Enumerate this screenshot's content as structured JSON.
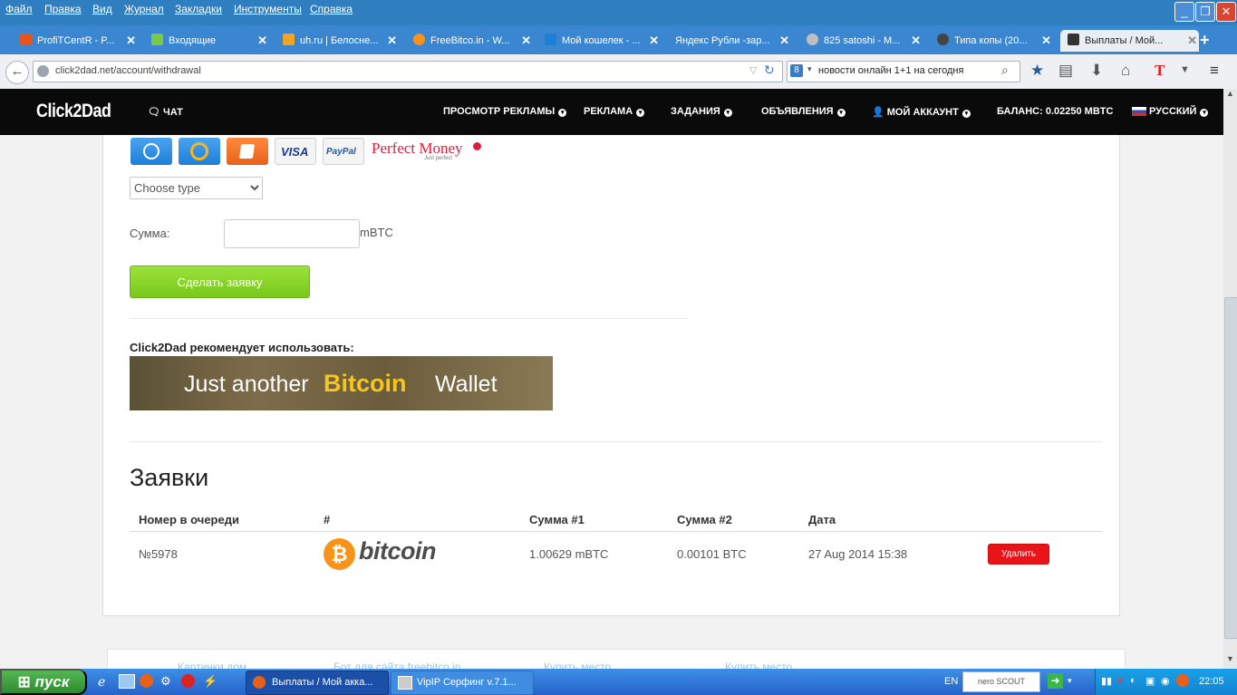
{
  "menubar": {
    "items": [
      "Файл",
      "Правка",
      "Вид",
      "Журнал",
      "Закладки",
      "Инструменты",
      "Справка"
    ]
  },
  "tabs": [
    {
      "label": "ProfiTCentR - P...",
      "icon_color": "#e8541a"
    },
    {
      "label": "Входящие",
      "icon_color": "#7ac943"
    },
    {
      "label": "uh.ru | Белосне...",
      "icon_color": "#f2a323"
    },
    {
      "label": "FreeBitco.in - W...",
      "icon_color": "#f7931a"
    },
    {
      "label": "Мой кошелек - ...",
      "icon_color": "#1c7fd6"
    },
    {
      "label": "Яндекс Рубли -зар...",
      "icon_color": "#3b86d0"
    },
    {
      "label": "825 satoshi - M...",
      "icon_color": "#bfbfbf"
    },
    {
      "label": "Типа копы (20...",
      "icon_color": "#444444"
    },
    {
      "label": "Выплаты / Мой...",
      "icon_color": "#333333",
      "active": true
    }
  ],
  "navbar": {
    "url": "click2dad.net/account/withdrawal",
    "search_value": "новости онлайн 1+1 на сегодня"
  },
  "site": {
    "logo": "Click2Dad",
    "chat": "ЧАТ",
    "nav": [
      "ПРОСМОТР РЕКЛАМЫ",
      "РЕКЛАМА",
      "ЗАДАНИЯ",
      "ОБЪЯВЛЕНИЯ",
      "МОЙ АККАУНТ"
    ],
    "balance": "БАЛАНС: 0.02250 MBTC",
    "language": "РУССКИЙ"
  },
  "payment_methods": [
    "WebMoney",
    "Qiwi",
    "Яндекс",
    "VISA",
    "PayPal",
    "Perfect Money"
  ],
  "payment_labels": {
    "visa": "VISA",
    "paypal": "PayPal",
    "pm_1": "Perfect",
    "pm_2": "Money",
    "pm_sub": "Just perfect"
  },
  "form": {
    "type_select": "Choose type",
    "amount_label": "Сумма:",
    "amount_value": "",
    "unit": "mBTC",
    "submit": "Сделать заявку"
  },
  "recommend": {
    "title": "Click2Dad рекомендует использовать:",
    "banner_part1": "Just another",
    "banner_part2": "Bitcoin",
    "banner_part3": "Wallet"
  },
  "requests": {
    "title": "Заявки",
    "headers": [
      "Номер в очереди",
      "#",
      "Сумма #1",
      "Сумма #2",
      "Дата"
    ],
    "rows": [
      {
        "queue": "№5978",
        "method": "bitcoin",
        "sum1": "1.00629 mBTC",
        "sum2": "0.00101 BTC",
        "date": "27 Aug 2014 15:38",
        "action": "Удалить"
      }
    ]
  },
  "footer": {
    "links": [
      "Картинки дом",
      "Бот для сайта freebitco.in",
      "Купить место",
      "Купить место"
    ]
  },
  "taskbar": {
    "start": "пуск",
    "tasks": [
      "Выплаты / Мой акка...",
      "VipIP Серфинг  v.7.1..."
    ],
    "lang": "EN",
    "nero": "nero SCOUT",
    "clock": "22:05"
  }
}
